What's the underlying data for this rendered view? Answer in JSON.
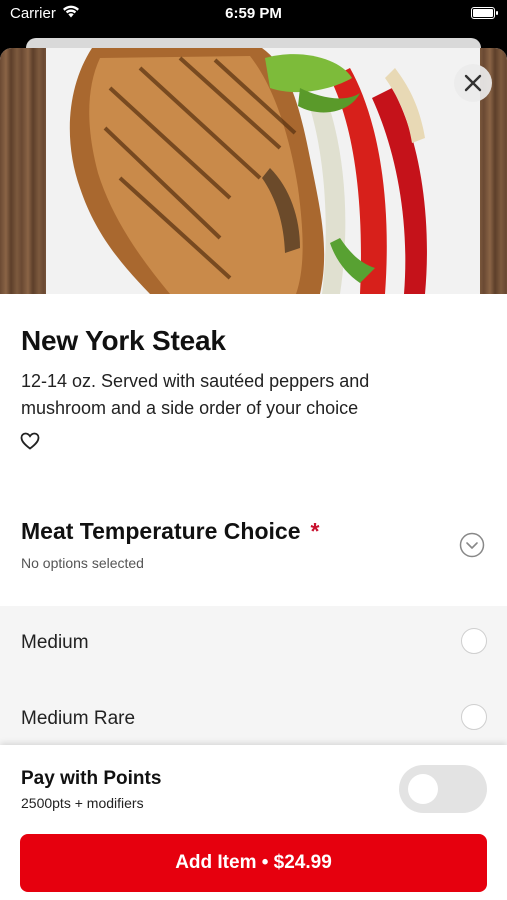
{
  "status_bar": {
    "carrier": "Carrier",
    "time": "6:59 PM"
  },
  "item": {
    "name": "New York Steak",
    "description": "12-14 oz. Served with sautéed peppers and mushroom and a side order of your choice"
  },
  "modifier_group": {
    "title": "Meat Temperature Choice",
    "required_marker": "*",
    "subtitle": "No options selected",
    "options": [
      {
        "label": "Medium",
        "selected": false
      },
      {
        "label": "Medium Rare",
        "selected": false
      }
    ]
  },
  "points": {
    "title": "Pay with Points",
    "subtitle": "2500pts + modifiers",
    "enabled": false
  },
  "add_button": {
    "label": "Add Item • $24.99"
  },
  "colors": {
    "accent": "#e6000e",
    "required": "#c8102e",
    "toggle_off": "#e3e3e3"
  },
  "icons": {
    "wifi": "wifi-icon",
    "battery": "battery-icon",
    "close": "close-icon",
    "favorite": "heart-outline-icon",
    "expand": "chevron-down-circle-icon"
  }
}
